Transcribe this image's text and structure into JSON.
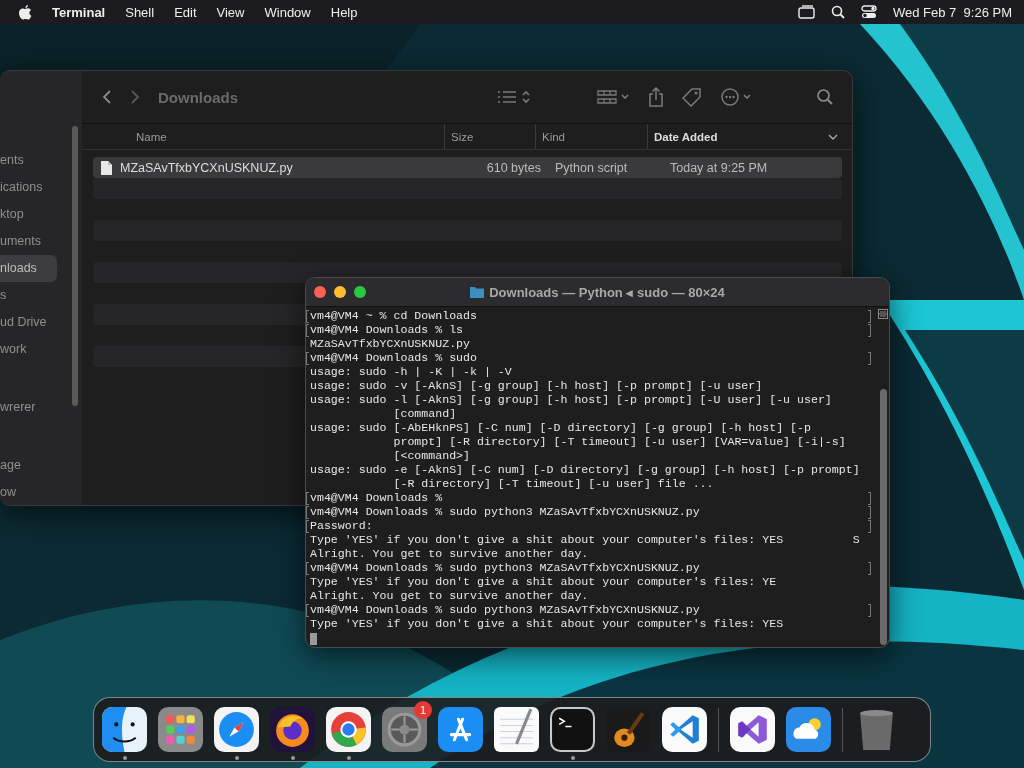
{
  "menu_bar": {
    "app_name": "Terminal",
    "menus": [
      "Shell",
      "Edit",
      "View",
      "Window",
      "Help"
    ],
    "clock": "Wed Feb 7  9:26 PM"
  },
  "finder": {
    "title": "Downloads",
    "sidebar": [
      {
        "label": "ents",
        "selected": false
      },
      {
        "label": "ications",
        "selected": false
      },
      {
        "label": "ktop",
        "selected": false
      },
      {
        "label": "uments",
        "selected": false
      },
      {
        "label": "nloads",
        "selected": true
      },
      {
        "label": "s",
        "selected": false
      },
      {
        "label": "ud Drive",
        "selected": false
      },
      {
        "label": "work",
        "selected": false
      },
      {
        "label": "wrerer",
        "selected": false
      },
      {
        "label": "age",
        "selected": false
      },
      {
        "label": "ow",
        "selected": false
      }
    ],
    "columns": [
      {
        "label": "Name",
        "sorted": false
      },
      {
        "label": "Size",
        "sorted": false
      },
      {
        "label": "Kind",
        "sorted": false
      },
      {
        "label": "Date Added",
        "sorted": true
      }
    ],
    "files": [
      {
        "name": "MZaSAvTfxbYCXnUSKNUZ.py",
        "size": "610 bytes",
        "kind": "Python script",
        "date_added": "Today at 9:25 PM",
        "selected": true
      }
    ]
  },
  "terminal": {
    "title": "Downloads — Python ◂ sudo — 80×24",
    "cursor": true,
    "lines": [
      {
        "text": "vm4@VM4 ~ % cd Downloads",
        "marked": true
      },
      {
        "text": "vm4@VM4 Downloads % ls",
        "marked": true
      },
      {
        "text": "MZaSAvTfxbYCXnUSKNUZ.py",
        "marked": false
      },
      {
        "text": "vm4@VM4 Downloads % sudo",
        "marked": true
      },
      {
        "text": "usage: sudo -h | -K | -k | -V",
        "marked": false
      },
      {
        "text": "usage: sudo -v [-AknS] [-g group] [-h host] [-p prompt] [-u user]",
        "marked": false
      },
      {
        "text": "usage: sudo -l [-AknS] [-g group] [-h host] [-p prompt] [-U user] [-u user]",
        "marked": false
      },
      {
        "text": "            [command]",
        "marked": false
      },
      {
        "text": "usage: sudo [-AbEHknPS] [-C num] [-D directory] [-g group] [-h host] [-p",
        "marked": false
      },
      {
        "text": "            prompt] [-R directory] [-T timeout] [-u user] [VAR=value] [-i|-s]",
        "marked": false
      },
      {
        "text": "            [<command>]",
        "marked": false
      },
      {
        "text": "usage: sudo -e [-AknS] [-C num] [-D directory] [-g group] [-h host] [-p prompt]",
        "marked": false
      },
      {
        "text": "            [-R directory] [-T timeout] [-u user] file ...",
        "marked": false
      },
      {
        "text": "vm4@VM4 Downloads %",
        "marked": true
      },
      {
        "text": "vm4@VM4 Downloads % sudo python3 MZaSAvTfxbYCXnUSKNUZ.py",
        "marked": true
      },
      {
        "text": "Password:",
        "marked": true
      },
      {
        "text": "Type 'YES' if you don't give a shit about your computer's files: YES          S",
        "marked": false
      },
      {
        "text": "Alright. You get to survive another day.",
        "marked": false
      },
      {
        "text": "vm4@VM4 Downloads % sudo python3 MZaSAvTfxbYCXnUSKNUZ.py",
        "marked": true
      },
      {
        "text": "Type 'YES' if you don't give a shit about your computer's files: YE",
        "marked": false
      },
      {
        "text": "Alright. You get to survive another day.",
        "marked": false
      },
      {
        "text": "vm4@VM4 Downloads % sudo python3 MZaSAvTfxbYCXnUSKNUZ.py",
        "marked": true
      },
      {
        "text": "Type 'YES' if you don't give a shit about your computer's files: YES",
        "marked": false
      }
    ]
  },
  "dock": {
    "apps": [
      {
        "running": true
      },
      {
        "running": false
      },
      {
        "running": true
      },
      {
        "running": true
      },
      {
        "running": true
      },
      {
        "running": false,
        "badge": "1"
      },
      {
        "running": false
      },
      {
        "running": false
      },
      {
        "running": true
      },
      {
        "running": false
      },
      {
        "running": false
      },
      {
        "running": false
      },
      {
        "running": false
      },
      {
        "running": false
      }
    ]
  }
}
